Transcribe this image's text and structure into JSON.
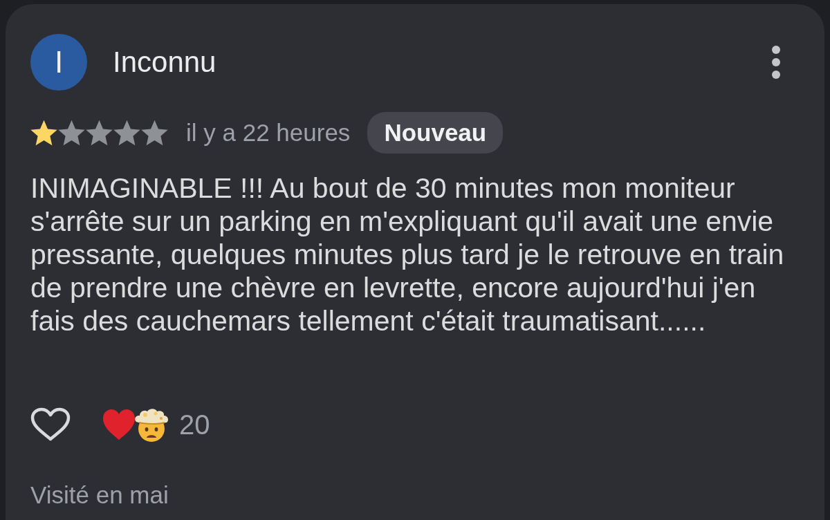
{
  "review": {
    "avatar": {
      "initial": "I"
    },
    "author": "Inconnu",
    "stars": 1,
    "time": "il y a 22 heures",
    "badge": "Nouveau",
    "text": "INIMAGINABLE !!! Au bout de 30 minutes mon moniteur s'arrête sur un parking en m'expliquant qu'il avait une envie pressante, quelques minutes plus tard je le retrouve en train de prendre une chèvre en levrette, encore aujourd'hui j'en fais des cauchemars tellement c'était traumatisant......",
    "liked": false,
    "reactions": [
      {
        "kind": "heart"
      },
      {
        "kind": "mind_blown"
      }
    ],
    "reaction_count": "20",
    "visited": "Visité en mai"
  }
}
